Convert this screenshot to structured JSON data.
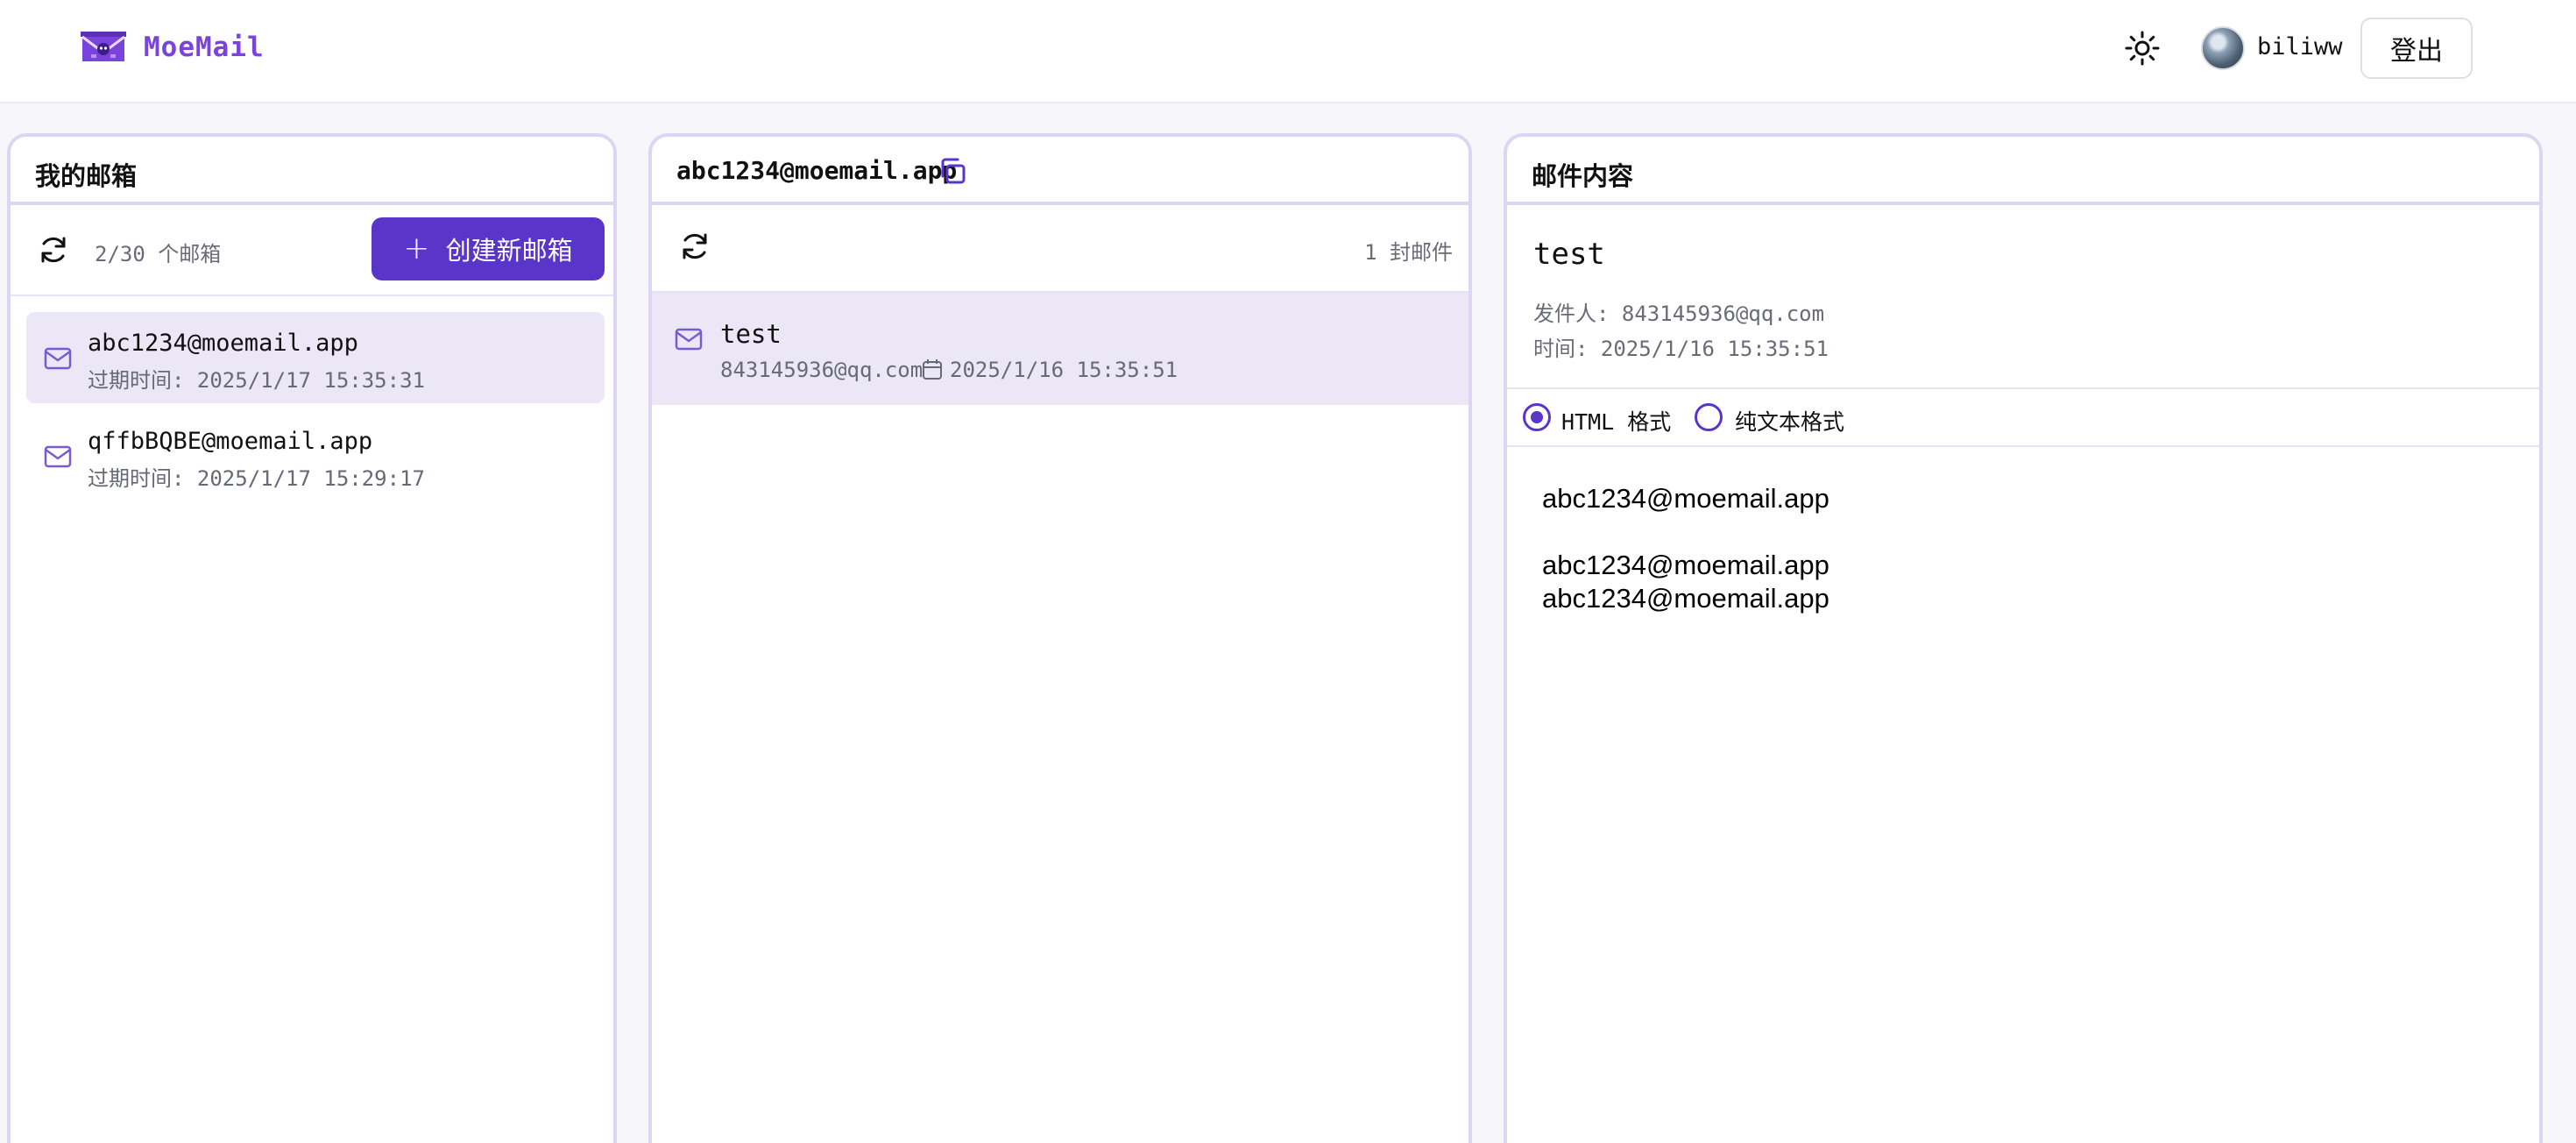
{
  "header": {
    "brand": "MoeMail",
    "username": "biliww",
    "logout_label": "登出"
  },
  "mailboxes_panel": {
    "title": "我的邮箱",
    "count_text": "2/30 个邮箱",
    "create_label": "创建新邮箱",
    "items": [
      {
        "address": "abc1234@moemail.app",
        "expires": "过期时间: 2025/1/17 15:35:31",
        "active": true
      },
      {
        "address": "qffbBQBE@moemail.app",
        "expires": "过期时间: 2025/1/17 15:29:17",
        "active": false
      }
    ]
  },
  "messages_panel": {
    "title": "abc1234@moemail.app",
    "count_text": "1 封邮件",
    "items": [
      {
        "subject": "test",
        "from": "843145936@qq.com",
        "time": "2025/1/16 15:35:51"
      }
    ]
  },
  "content_panel": {
    "title": "邮件内容",
    "subject": "test",
    "from": "发件人: 843145936@qq.com",
    "time": "时间: 2025/1/16 15:35:51",
    "format_html_label": "HTML 格式",
    "format_text_label": "纯文本格式",
    "selected_format": "html",
    "body_lines": [
      "abc1234@moemail.app",
      "",
      "abc1234@moemail.app",
      "abc1234@moemail.app"
    ]
  },
  "colors": {
    "accent": "#5a35c9",
    "brand": "#7a43dc",
    "panel_border": "#ddd5f3",
    "selected_bg": "#ebe7f7"
  },
  "icons": {
    "logo": "envelope-logo-icon",
    "theme": "sun-icon",
    "copy": "copy-icon",
    "refresh": "refresh-icon",
    "mail": "mail-icon",
    "calendar": "calendar-icon",
    "plus": "plus-icon"
  }
}
